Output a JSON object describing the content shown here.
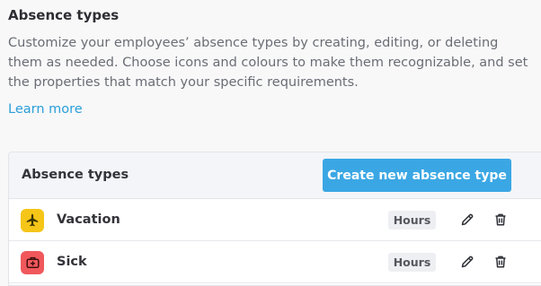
{
  "intro": {
    "title": "Absence types",
    "description": "Customize your employees’ absence types by creating, editing, or deleting them as needed. Choose icons and colours to make them recognizable, and set the properties that match your specific requirements.",
    "learn_more": "Learn more"
  },
  "panel": {
    "title": "Absence types",
    "create_button": "Create new absence type"
  },
  "absence_types": [
    {
      "name": "Vacation",
      "unit": "Hours",
      "icon": "airplane-icon",
      "color": "#f5c518"
    },
    {
      "name": "Sick",
      "unit": "Hours",
      "icon": "first-aid-kit-icon",
      "color": "#f0585c"
    }
  ],
  "row_actions": {
    "edit_icon": "pencil-icon",
    "delete_icon": "trash-icon"
  },
  "colors": {
    "accent": "#3aa7e4",
    "link": "#2b9ed8"
  }
}
